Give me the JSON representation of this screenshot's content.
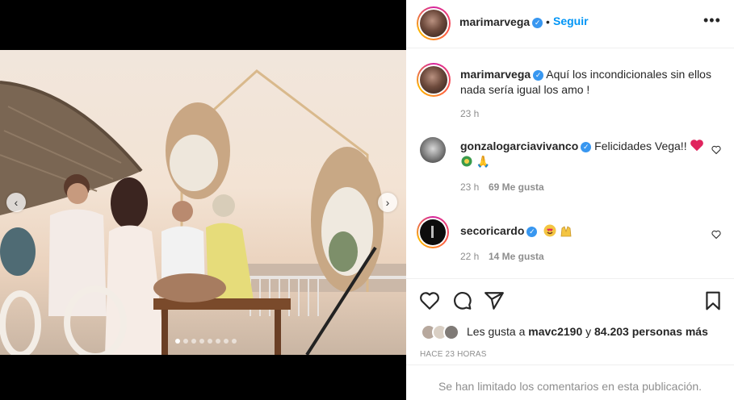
{
  "post": {
    "username": "marimarvega",
    "verified": true,
    "follow_label": "Seguir",
    "follow_separator": "•",
    "more_label": "•••"
  },
  "caption": {
    "username": "marimarvega",
    "text": "Aquí los incondicionales sin ellos nada sería igual los amo !",
    "time": "23 h"
  },
  "comments": [
    {
      "username": "gonzalogarciavivanco",
      "text": "Felicidades Vega!!",
      "emoji_line": "🙏",
      "time": "23 h",
      "likes": "69 Me gusta"
    },
    {
      "username": "secoricardo",
      "text": "",
      "time": "22 h",
      "likes": "14 Me gusta"
    }
  ],
  "likes": {
    "prefix": "Les gusta a",
    "first_user": "mavc2190",
    "connector": "y",
    "others": "84.203 personas más"
  },
  "post_time": "HACE 23 HORAS",
  "footer_text": "Se han limitado los comentarios en esta publicación.",
  "carousel": {
    "total": 10,
    "active": 0
  },
  "colors": {
    "accent": "#0095f6",
    "verified": "#3897f0",
    "heart": "#ed4956",
    "muted": "#8e8e8e"
  },
  "icons": [
    "heart-icon",
    "comment-icon",
    "share-icon",
    "save-icon",
    "verified-icon",
    "more-icon",
    "chevron-left-icon",
    "chevron-right-icon"
  ]
}
